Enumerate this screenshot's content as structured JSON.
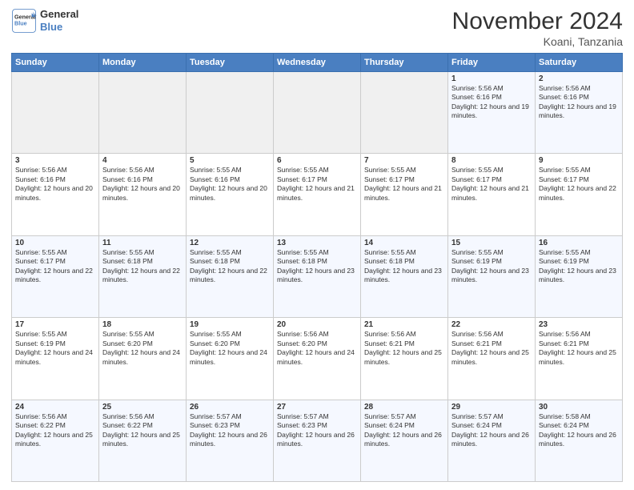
{
  "logo": {
    "line1": "General",
    "line2": "Blue"
  },
  "header": {
    "month": "November 2024",
    "location": "Koani, Tanzania"
  },
  "weekdays": [
    "Sunday",
    "Monday",
    "Tuesday",
    "Wednesday",
    "Thursday",
    "Friday",
    "Saturday"
  ],
  "weeks": [
    [
      {
        "day": "",
        "info": ""
      },
      {
        "day": "",
        "info": ""
      },
      {
        "day": "",
        "info": ""
      },
      {
        "day": "",
        "info": ""
      },
      {
        "day": "",
        "info": ""
      },
      {
        "day": "1",
        "info": "Sunrise: 5:56 AM\nSunset: 6:16 PM\nDaylight: 12 hours and 19 minutes."
      },
      {
        "day": "2",
        "info": "Sunrise: 5:56 AM\nSunset: 6:16 PM\nDaylight: 12 hours and 19 minutes."
      }
    ],
    [
      {
        "day": "3",
        "info": "Sunrise: 5:56 AM\nSunset: 6:16 PM\nDaylight: 12 hours and 20 minutes."
      },
      {
        "day": "4",
        "info": "Sunrise: 5:56 AM\nSunset: 6:16 PM\nDaylight: 12 hours and 20 minutes."
      },
      {
        "day": "5",
        "info": "Sunrise: 5:55 AM\nSunset: 6:16 PM\nDaylight: 12 hours and 20 minutes."
      },
      {
        "day": "6",
        "info": "Sunrise: 5:55 AM\nSunset: 6:17 PM\nDaylight: 12 hours and 21 minutes."
      },
      {
        "day": "7",
        "info": "Sunrise: 5:55 AM\nSunset: 6:17 PM\nDaylight: 12 hours and 21 minutes."
      },
      {
        "day": "8",
        "info": "Sunrise: 5:55 AM\nSunset: 6:17 PM\nDaylight: 12 hours and 21 minutes."
      },
      {
        "day": "9",
        "info": "Sunrise: 5:55 AM\nSunset: 6:17 PM\nDaylight: 12 hours and 22 minutes."
      }
    ],
    [
      {
        "day": "10",
        "info": "Sunrise: 5:55 AM\nSunset: 6:17 PM\nDaylight: 12 hours and 22 minutes."
      },
      {
        "day": "11",
        "info": "Sunrise: 5:55 AM\nSunset: 6:18 PM\nDaylight: 12 hours and 22 minutes."
      },
      {
        "day": "12",
        "info": "Sunrise: 5:55 AM\nSunset: 6:18 PM\nDaylight: 12 hours and 22 minutes."
      },
      {
        "day": "13",
        "info": "Sunrise: 5:55 AM\nSunset: 6:18 PM\nDaylight: 12 hours and 23 minutes."
      },
      {
        "day": "14",
        "info": "Sunrise: 5:55 AM\nSunset: 6:18 PM\nDaylight: 12 hours and 23 minutes."
      },
      {
        "day": "15",
        "info": "Sunrise: 5:55 AM\nSunset: 6:19 PM\nDaylight: 12 hours and 23 minutes."
      },
      {
        "day": "16",
        "info": "Sunrise: 5:55 AM\nSunset: 6:19 PM\nDaylight: 12 hours and 23 minutes."
      }
    ],
    [
      {
        "day": "17",
        "info": "Sunrise: 5:55 AM\nSunset: 6:19 PM\nDaylight: 12 hours and 24 minutes."
      },
      {
        "day": "18",
        "info": "Sunrise: 5:55 AM\nSunset: 6:20 PM\nDaylight: 12 hours and 24 minutes."
      },
      {
        "day": "19",
        "info": "Sunrise: 5:55 AM\nSunset: 6:20 PM\nDaylight: 12 hours and 24 minutes."
      },
      {
        "day": "20",
        "info": "Sunrise: 5:56 AM\nSunset: 6:20 PM\nDaylight: 12 hours and 24 minutes."
      },
      {
        "day": "21",
        "info": "Sunrise: 5:56 AM\nSunset: 6:21 PM\nDaylight: 12 hours and 25 minutes."
      },
      {
        "day": "22",
        "info": "Sunrise: 5:56 AM\nSunset: 6:21 PM\nDaylight: 12 hours and 25 minutes."
      },
      {
        "day": "23",
        "info": "Sunrise: 5:56 AM\nSunset: 6:21 PM\nDaylight: 12 hours and 25 minutes."
      }
    ],
    [
      {
        "day": "24",
        "info": "Sunrise: 5:56 AM\nSunset: 6:22 PM\nDaylight: 12 hours and 25 minutes."
      },
      {
        "day": "25",
        "info": "Sunrise: 5:56 AM\nSunset: 6:22 PM\nDaylight: 12 hours and 25 minutes."
      },
      {
        "day": "26",
        "info": "Sunrise: 5:57 AM\nSunset: 6:23 PM\nDaylight: 12 hours and 26 minutes."
      },
      {
        "day": "27",
        "info": "Sunrise: 5:57 AM\nSunset: 6:23 PM\nDaylight: 12 hours and 26 minutes."
      },
      {
        "day": "28",
        "info": "Sunrise: 5:57 AM\nSunset: 6:24 PM\nDaylight: 12 hours and 26 minutes."
      },
      {
        "day": "29",
        "info": "Sunrise: 5:57 AM\nSunset: 6:24 PM\nDaylight: 12 hours and 26 minutes."
      },
      {
        "day": "30",
        "info": "Sunrise: 5:58 AM\nSunset: 6:24 PM\nDaylight: 12 hours and 26 minutes."
      }
    ]
  ]
}
